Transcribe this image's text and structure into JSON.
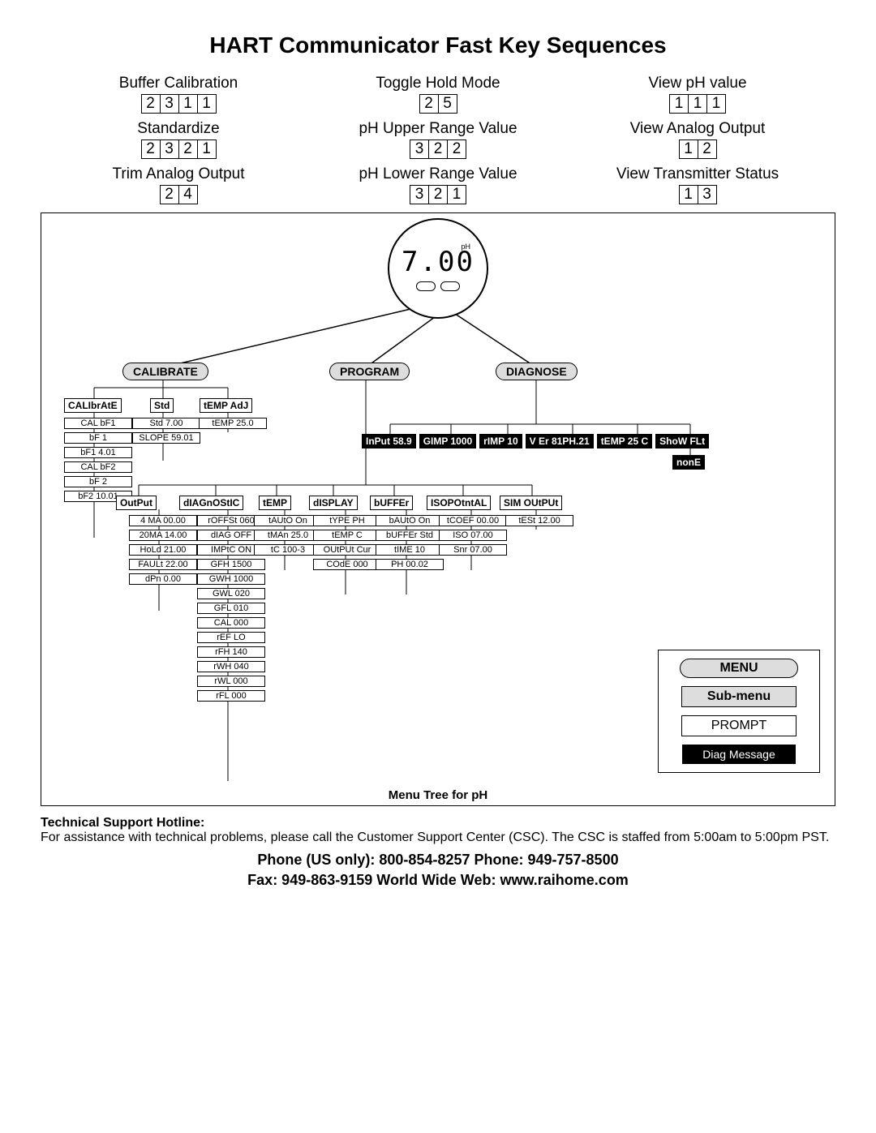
{
  "title": "HART Communicator Fast Key Sequences",
  "fastkeys": [
    {
      "label": "Buffer Calibration",
      "keys": [
        "2",
        "3",
        "1",
        "1"
      ]
    },
    {
      "label": "Toggle Hold Mode",
      "keys": [
        "2",
        "5"
      ]
    },
    {
      "label": "View pH value",
      "keys": [
        "1",
        "1",
        "1"
      ]
    },
    {
      "label": "Standardize",
      "keys": [
        "2",
        "3",
        "2",
        "1"
      ]
    },
    {
      "label": "pH Upper Range Value",
      "keys": [
        "3",
        "2",
        "2"
      ]
    },
    {
      "label": "View Analog Output",
      "keys": [
        "1",
        "2"
      ]
    },
    {
      "label": "Trim Analog Output",
      "keys": [
        "2",
        "4"
      ]
    },
    {
      "label": "pH Lower Range Value",
      "keys": [
        "3",
        "2",
        "1"
      ]
    },
    {
      "label": "View Transmitter Status",
      "keys": [
        "1",
        "3"
      ]
    }
  ],
  "display": {
    "value": "7.00",
    "unit": "pH"
  },
  "menus": {
    "calibrate": "CALIBRATE",
    "program": "PROGRAM",
    "diagnose": "DIAGNOSE"
  },
  "cal_subs": {
    "calibrate": "CALIbrAtE",
    "std": "Std",
    "tempadj": "tEMP AdJ"
  },
  "cal_prompts": {
    "calibrate": [
      "CAL bF1",
      "bF 1",
      "bF1 4.01",
      "CAL bF2",
      "bF 2",
      "bF2 10.01"
    ],
    "std": [
      "Std 7.00",
      "SLOPE 59.01"
    ],
    "tempadj": [
      "tEMP 25.0"
    ]
  },
  "diag_subs": [
    "InPut 58.9",
    "GIMP 1000",
    "rIMP 10",
    "V Er 81PH.21",
    "tEMP 25 C",
    "ShoW FLt"
  ],
  "diag_msg": "nonE",
  "prog_subs": {
    "output": "OutPut",
    "diagnostic": "dIAGnOStIC",
    "temp": "tEMP",
    "display": "dISPLAY",
    "buffer": "bUFFEr",
    "iso": "ISOPOtntAL",
    "sim": "SIM OUtPUt"
  },
  "prog_prompts": {
    "output": [
      "4 MA 00.00",
      "20MA 14.00",
      "HoLd 21.00",
      "FAULt 22.00",
      "dPn 0.00"
    ],
    "diagnostic": [
      "rOFFSt 060",
      "dIAG OFF",
      "IMPtC ON",
      "GFH 1500",
      "GWH 1000",
      "GWL 020",
      "GFL 010",
      "CAL 000",
      "rEF  LO",
      "rFH 140",
      "rWH 040",
      "rWL 000",
      "rFL 000"
    ],
    "temp": [
      "tAUtO On",
      "tMAn 25.0",
      "tC 100-3"
    ],
    "display": [
      "tYPE PH",
      "tEMP C",
      "OUtPUt Cur",
      "COdE 000"
    ],
    "buffer": [
      "bAUtO On",
      "bUFFEr Std",
      "tIME 10",
      "PH 00.02"
    ],
    "iso": [
      "tCOEF 00.00",
      "ISO 07.00",
      "Snr 07.00"
    ],
    "sim": [
      "tESt 12.00"
    ]
  },
  "caption": "Menu Tree for pH",
  "legend": {
    "menu": "MENU",
    "sub": "Sub-menu",
    "prompt": "PROMPT",
    "diag": "Diag Message"
  },
  "footer": {
    "hotline": "Technical Support Hotline:",
    "body": "For assistance with technical problems, please call the Customer Support Center (CSC).  The CSC is staffed from 5:00am to 5:00pm PST.",
    "c1": "Phone (US only): 800-854-8257      Phone: 949-757-8500",
    "c2": "Fax: 949-863-9159     World Wide Web: www.raihome.com"
  }
}
